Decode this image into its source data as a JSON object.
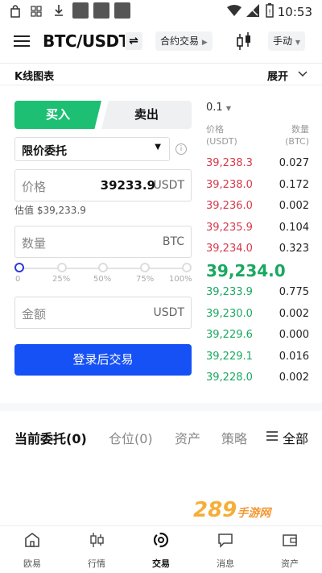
{
  "status_bar": {
    "time": "10:53"
  },
  "header": {
    "pair": "BTC/USDT",
    "swap_icon": "swap-icon",
    "contract": "合约交易",
    "mode": "手动"
  },
  "kline": {
    "label": "K线图表",
    "expand": "展开"
  },
  "trade": {
    "buy": "买入",
    "sell": "卖出",
    "order_type": "限价委托",
    "price_placeholder": "价格",
    "price_value": "39233.9",
    "price_unit": "USDT",
    "estimate": "估值 $39,233.9",
    "qty_placeholder": "数量",
    "qty_unit": "BTC",
    "amount_placeholder": "金额",
    "amount_unit": "USDT",
    "slider_marks": [
      "0",
      "25%",
      "50%",
      "75%",
      "100%"
    ],
    "slider_value": 0,
    "login_button": "登录后交易"
  },
  "orderbook": {
    "depth": "0.1",
    "price_header": "价格",
    "price_unit": "(USDT)",
    "qty_header": "数量",
    "qty_unit": "(BTC)",
    "asks": [
      {
        "price": "39,238.3",
        "qty": "0.027"
      },
      {
        "price": "39,238.0",
        "qty": "0.172"
      },
      {
        "price": "39,236.0",
        "qty": "0.002"
      },
      {
        "price": "39,235.9",
        "qty": "0.104"
      },
      {
        "price": "39,234.0",
        "qty": "0.323"
      }
    ],
    "last_price": "39,234.0",
    "bids": [
      {
        "price": "39,233.9",
        "qty": "0.775"
      },
      {
        "price": "39,230.0",
        "qty": "0.002"
      },
      {
        "price": "39,229.6",
        "qty": "0.000"
      },
      {
        "price": "39,229.1",
        "qty": "0.016"
      },
      {
        "price": "39,228.0",
        "qty": "0.002"
      }
    ],
    "colors": {
      "ask": "#d6394a",
      "bid": "#1aa860"
    }
  },
  "orders_tabs": [
    "当前委托(0)",
    "仓位(0)",
    "资产",
    "策略"
  ],
  "orders_filter": "全部",
  "nav": [
    "欧易",
    "行情",
    "交易",
    "消息",
    "资产"
  ],
  "watermark": {
    "text": "289",
    "sub": "手游网"
  }
}
